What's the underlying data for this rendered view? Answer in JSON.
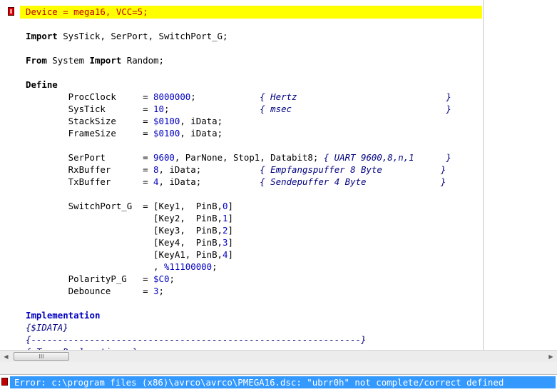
{
  "editor": {
    "lines": [
      {
        "id": "device",
        "parts": [
          [
            "Device = mega16, VCC=5;",
            "red"
          ]
        ]
      },
      {
        "id": "import",
        "parts": [
          [
            "Import",
            "kw"
          ],
          [
            " SysTick, SerPort, SwitchPort_G;",
            ""
          ]
        ]
      },
      {
        "id": "from",
        "parts": [
          [
            "From",
            "kw"
          ],
          [
            " System ",
            ""
          ],
          [
            "Import",
            "kw"
          ],
          [
            " Random;",
            ""
          ]
        ]
      },
      {
        "id": "define",
        "parts": [
          [
            "Define",
            "kw"
          ]
        ]
      },
      {
        "id": "procclock",
        "parts": [
          [
            "        ProcClock     = ",
            ""
          ],
          [
            "8000000",
            "num"
          ],
          [
            ";            ",
            ""
          ],
          [
            "{ Hertz                            }",
            "cmt"
          ]
        ]
      },
      {
        "id": "systick",
        "parts": [
          [
            "        SysTick       = ",
            ""
          ],
          [
            "10",
            "num"
          ],
          [
            ";                 ",
            ""
          ],
          [
            "{ msec                             }",
            "cmt"
          ]
        ]
      },
      {
        "id": "stacksize",
        "parts": [
          [
            "        StackSize     = ",
            ""
          ],
          [
            "$0100",
            "num"
          ],
          [
            ", iData;",
            ""
          ]
        ]
      },
      {
        "id": "framesize",
        "parts": [
          [
            "        FrameSize     = ",
            ""
          ],
          [
            "$0100",
            "num"
          ],
          [
            ", iData;",
            ""
          ]
        ]
      },
      {
        "id": "serport",
        "parts": [
          [
            "        SerPort       = ",
            ""
          ],
          [
            "9600",
            "num"
          ],
          [
            ", ParNone, Stop1, Databit8; ",
            ""
          ],
          [
            "{ UART 9600,8,n,1      }",
            "cmt"
          ]
        ]
      },
      {
        "id": "rxbuffer",
        "parts": [
          [
            "        RxBuffer      = ",
            ""
          ],
          [
            "8",
            "num"
          ],
          [
            ", iData;           ",
            ""
          ],
          [
            "{ Empfangspuffer 8 Byte           }",
            "cmt"
          ]
        ]
      },
      {
        "id": "txbuffer",
        "parts": [
          [
            "        TxBuffer      = ",
            ""
          ],
          [
            "4",
            "num"
          ],
          [
            ", iData;           ",
            ""
          ],
          [
            "{ Sendepuffer 4 Byte              }",
            "cmt"
          ]
        ]
      },
      {
        "id": "switchport1",
        "parts": [
          [
            "        SwitchPort_G  = [Key1,  PinB,",
            ""
          ],
          [
            "0",
            "num"
          ],
          [
            "]",
            ""
          ]
        ]
      },
      {
        "id": "switchport2",
        "parts": [
          [
            "                        [Key2,  PinB,",
            ""
          ],
          [
            "1",
            "num"
          ],
          [
            "]",
            ""
          ]
        ]
      },
      {
        "id": "switchport3",
        "parts": [
          [
            "                        [Key3,  PinB,",
            ""
          ],
          [
            "2",
            "num"
          ],
          [
            "]",
            ""
          ]
        ]
      },
      {
        "id": "switchport4",
        "parts": [
          [
            "                        [Key4,  PinB,",
            ""
          ],
          [
            "3",
            "num"
          ],
          [
            "]",
            ""
          ]
        ]
      },
      {
        "id": "switchport5",
        "parts": [
          [
            "                        [KeyA1, PinB,",
            ""
          ],
          [
            "4",
            "num"
          ],
          [
            "]",
            ""
          ]
        ]
      },
      {
        "id": "switchport6",
        "parts": [
          [
            "                        , ",
            ""
          ],
          [
            "%11100000",
            "num"
          ],
          [
            ";",
            ""
          ]
        ]
      },
      {
        "id": "polarity",
        "parts": [
          [
            "        PolarityP_G   = ",
            ""
          ],
          [
            "$C0",
            "num"
          ],
          [
            ";",
            ""
          ]
        ]
      },
      {
        "id": "debounce",
        "parts": [
          [
            "        Debounce      = ",
            ""
          ],
          [
            "3",
            "num"
          ],
          [
            ";",
            ""
          ]
        ]
      },
      {
        "id": "implementation",
        "parts": [
          [
            "Implementation",
            "kw-blue"
          ]
        ]
      },
      {
        "id": "idata",
        "parts": [
          [
            "{$IDATA}",
            "cmt"
          ]
        ]
      },
      {
        "id": "separator",
        "parts": [
          [
            "{--------------------------------------------------------------}",
            "cmt"
          ]
        ]
      },
      {
        "id": "typedecl",
        "parts": [
          [
            "{ Type Declarations }",
            "cmt"
          ]
        ]
      }
    ]
  },
  "hscroll": {
    "left_arrow": "◀",
    "right_arrow": "▶",
    "thumb_grip": "III"
  },
  "status": {
    "error_text": "Error: c:\\program files (x86)\\avrco\\avrco\\PMEGA16.dsc: \"ubrr0h\" not complete/correct defined"
  }
}
